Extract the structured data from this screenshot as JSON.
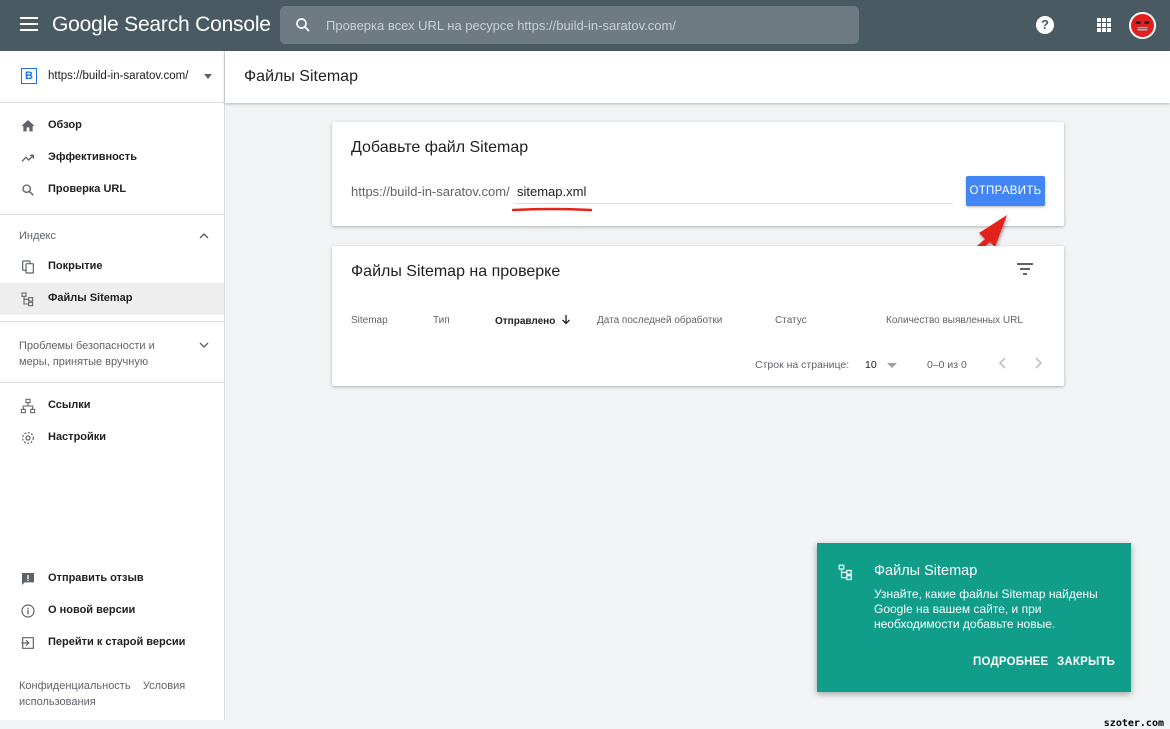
{
  "app": {
    "brand": "Google Search Console",
    "search_placeholder": "Проверка всех URL на ресурсе https://build-in-saratov.com/",
    "help_glyph": "?"
  },
  "sidebar": {
    "property_badge": "B",
    "property_url": "https://build-in-saratov.com/",
    "top_items": [
      {
        "label": "Обзор",
        "icon": "home-icon"
      },
      {
        "label": "Эффективность",
        "icon": "trending-up-icon"
      },
      {
        "label": "Проверка URL",
        "icon": "search-icon"
      }
    ],
    "index_section": "Индекс",
    "index_items": [
      {
        "label": "Покрытие",
        "icon": "copy-icon"
      },
      {
        "label": "Файлы Sitemap",
        "icon": "sitemap-icon",
        "active": true
      }
    ],
    "security_section": "Проблемы безопасности и меры, принятые вручную",
    "other_items": [
      {
        "label": "Ссылки",
        "icon": "links-icon"
      },
      {
        "label": "Настройки",
        "icon": "settings-icon"
      }
    ],
    "bottom_items": [
      {
        "label": "Отправить отзыв",
        "icon": "feedback-icon"
      },
      {
        "label": "О новой версии",
        "icon": "info-icon"
      },
      {
        "label": "Перейти к старой версии",
        "icon": "exit-icon"
      }
    ],
    "footer": {
      "privacy": "Конфиденциальность",
      "terms": "Условия использования"
    }
  },
  "page": {
    "title": "Файлы Sitemap"
  },
  "add_card": {
    "title": "Добавьте файл Sitemap",
    "url_prefix": "https://build-in-saratov.com/",
    "input_value": "sitemap.xml",
    "submit_label": "ОТПРАВИТЬ"
  },
  "list_card": {
    "title": "Файлы Sitemap на проверке",
    "columns": [
      "Sitemap",
      "Тип",
      "Отправлено",
      "Дата последней обработки",
      "Статус",
      "Количество выявленных URL"
    ],
    "sorted_column": "Отправлено",
    "rows_per_page_label": "Строк на странице:",
    "rows_per_page": "10",
    "range": "0–0 из 0"
  },
  "toast": {
    "title": "Файлы Sitemap",
    "body": "Узнайте, какие файлы Sitemap найдены Google на вашем сайте, и при необходимости добавьте новые.",
    "more_label": "ПОДРОБНЕЕ",
    "close_label": "ЗАКРЫТЬ"
  },
  "watermark": "szoter.com",
  "colors": {
    "topbar": "#4a5a63",
    "accent_blue": "#4285f4",
    "toast_bg": "#109d8a",
    "annotation_red": "#e3231c"
  }
}
